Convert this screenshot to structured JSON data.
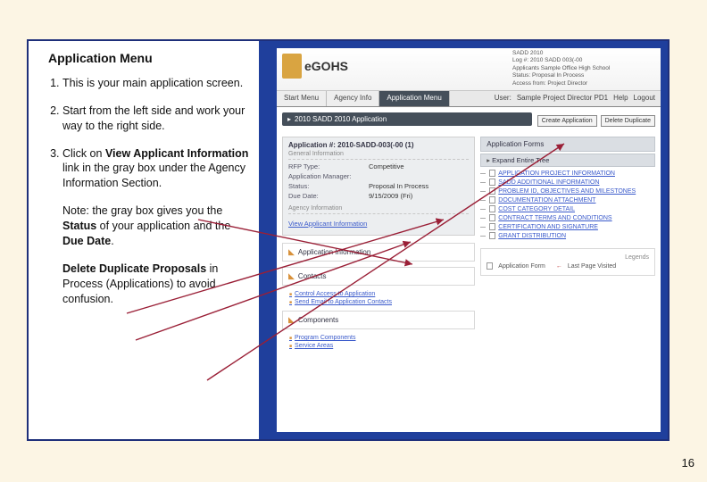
{
  "page_number": "16",
  "left": {
    "heading": "Application Menu",
    "step1": "This is your main application screen.",
    "step2": "Start from the left side and work your way to the right side.",
    "step3_a": "Click on ",
    "step3_b": "View Applicant Information",
    "step3_c": " link in the gray box under the Agency Information Section.",
    "note_a": "Note: the gray box gives you the ",
    "note_b": "Status",
    "note_c": " of your application and the ",
    "note_d": "Due Date",
    "note_e": ".",
    "del_a": "Delete Duplicate Proposals",
    "del_b": " in Process (Applications) to avoid confusion."
  },
  "app": {
    "logo_text": "eGOHS",
    "meta1": "SADD 2010",
    "meta2": "Log #: 2010 SADD 003(-00",
    "meta3": "Applicants Sample Office High School",
    "meta4": "Status: Proposal In Process",
    "meta5": "Access from: Project Director",
    "tabs": {
      "start": "Start Menu",
      "agency": "Agency Info",
      "appmenu": "Application Menu"
    },
    "user_label": "User:",
    "user_value": "Sample Project Director PD1",
    "help": "Help",
    "logout": "Logout",
    "banner": "2010 SADD 2010 Application",
    "btn_create": "Create Application",
    "btn_delete": "Delete Duplicate",
    "app_number_label": "Application #:",
    "app_number_value": "2010-SADD-003(-00 (1)",
    "gray": {
      "gen_hdr": "General Information",
      "rfp_k": "RFP Type:",
      "rfp_v": "Competitive",
      "mgr_k": "Application Manager:",
      "status_k": "Status:",
      "status_v": "Proposal In Process",
      "due_k": "Due Date:",
      "due_v": "9/15/2009 (Fri)",
      "agency_hdr": "Agency Information",
      "view_link": "View Applicant Information"
    },
    "sections": {
      "app_info": "Application Information",
      "contacts": "Contacts",
      "contacts_b1": "Control Access to Application",
      "contacts_b2": "Send Email to Application Contacts",
      "components": "Components",
      "components_b1": "Program Components",
      "components_b2": "Service Areas"
    },
    "forms": {
      "bar": "Application Forms",
      "expand": "Expand Entire Tree",
      "n1": "APPLICATION PROJECT INFORMATION",
      "n2": "SADD ADDITIONAL INFORMATION",
      "n3": "PROBLEM ID, OBJECTIVES AND MILESTONES",
      "n4": "DOCUMENTATION ATTACHMENT",
      "n5": "COST CATEGORY DETAIL",
      "n6": "CONTRACT TERMS AND CONDITIONS",
      "n7": "CERTIFICATION AND SIGNATURE",
      "n8": "GRANT DISTRIBUTION"
    },
    "legend": {
      "title": "Legends",
      "item1": "Application Form",
      "item2": "Last Page Visited"
    }
  }
}
